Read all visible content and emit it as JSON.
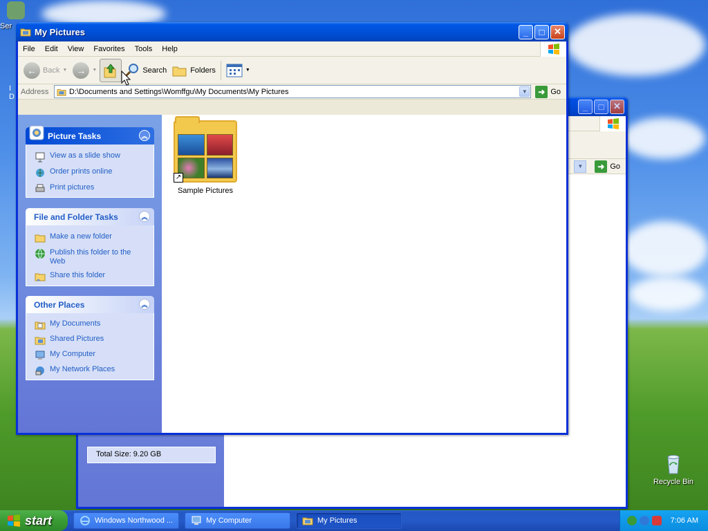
{
  "desktop": {
    "icons": [
      {
        "label": "Ser",
        "icon": "service-icon"
      },
      {
        "label": "Recycle Bin",
        "icon": "recycle-bin-icon"
      }
    ],
    "peek_letters": [
      "I",
      "D"
    ]
  },
  "back_window": {
    "status_text": "Total Size: 9.20 GB",
    "go_label": "Go"
  },
  "window": {
    "title": "My Pictures",
    "menu": [
      "File",
      "Edit",
      "View",
      "Favorites",
      "Tools",
      "Help"
    ],
    "toolbar": {
      "back_label": "Back",
      "search_label": "Search",
      "folders_label": "Folders"
    },
    "address": {
      "label": "Address",
      "path": "D:\\Documents and Settings\\Womffgu\\My Documents\\My Pictures",
      "go_label": "Go"
    },
    "panels": [
      {
        "title": "Picture Tasks",
        "links": [
          {
            "label": "View as a slide show",
            "icon": "slideshow-icon"
          },
          {
            "label": "Order prints online",
            "icon": "order-prints-icon"
          },
          {
            "label": "Print pictures",
            "icon": "printer-icon"
          }
        ]
      },
      {
        "title": "File and Folder Tasks",
        "links": [
          {
            "label": "Make a new folder",
            "icon": "new-folder-icon"
          },
          {
            "label": "Publish this folder to the Web",
            "icon": "globe-icon"
          },
          {
            "label": "Share this folder",
            "icon": "share-folder-icon"
          }
        ]
      },
      {
        "title": "Other Places",
        "links": [
          {
            "label": "My Documents",
            "icon": "my-documents-icon"
          },
          {
            "label": "Shared Pictures",
            "icon": "shared-pictures-icon"
          },
          {
            "label": "My Computer",
            "icon": "my-computer-icon"
          },
          {
            "label": "My Network Places",
            "icon": "network-places-icon"
          }
        ]
      }
    ],
    "items": [
      {
        "label": "Sample Pictures",
        "icon": "folder-icon",
        "shortcut": true
      }
    ]
  },
  "taskbar": {
    "start_label": "start",
    "tasks": [
      {
        "label": "Windows Northwood ...",
        "icon": "ie-icon",
        "active": false
      },
      {
        "label": "My Computer",
        "icon": "my-computer-icon",
        "active": false
      },
      {
        "label": "My Pictures",
        "icon": "folder-icon",
        "active": true
      }
    ],
    "clock": "7:06 AM"
  },
  "colors": {
    "title_blue": "#0054e3",
    "link_blue": "#215dc6",
    "panel_bg": "#d6dff7",
    "start_green": "#3a9b34"
  }
}
